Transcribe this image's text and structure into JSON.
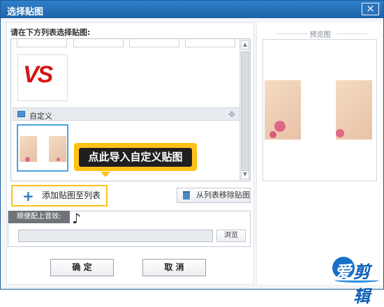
{
  "dialog": {
    "title": "选择贴图",
    "close_label": "×"
  },
  "left": {
    "instruction": "请在下方列表选择贴图:",
    "category_label": "自定义",
    "tooltip_text": "点此导入自定义贴图",
    "vs_text": "VS",
    "add_button_label": "添加贴图至列表",
    "remove_button_label": "从列表移除贴图"
  },
  "music": {
    "title": "顺便配上音效:",
    "path_value": "",
    "browse_label": "浏览"
  },
  "footer": {
    "ok_label": "确 定",
    "cancel_label": "取 消"
  },
  "preview": {
    "title": "预览图"
  },
  "brand": {
    "logo_text_left": "爱",
    "logo_text_right": "剪辑"
  },
  "colors": {
    "accent": "#ffc21a",
    "title_bar": "#1d63a8",
    "logo_blue": "#1770c9"
  }
}
